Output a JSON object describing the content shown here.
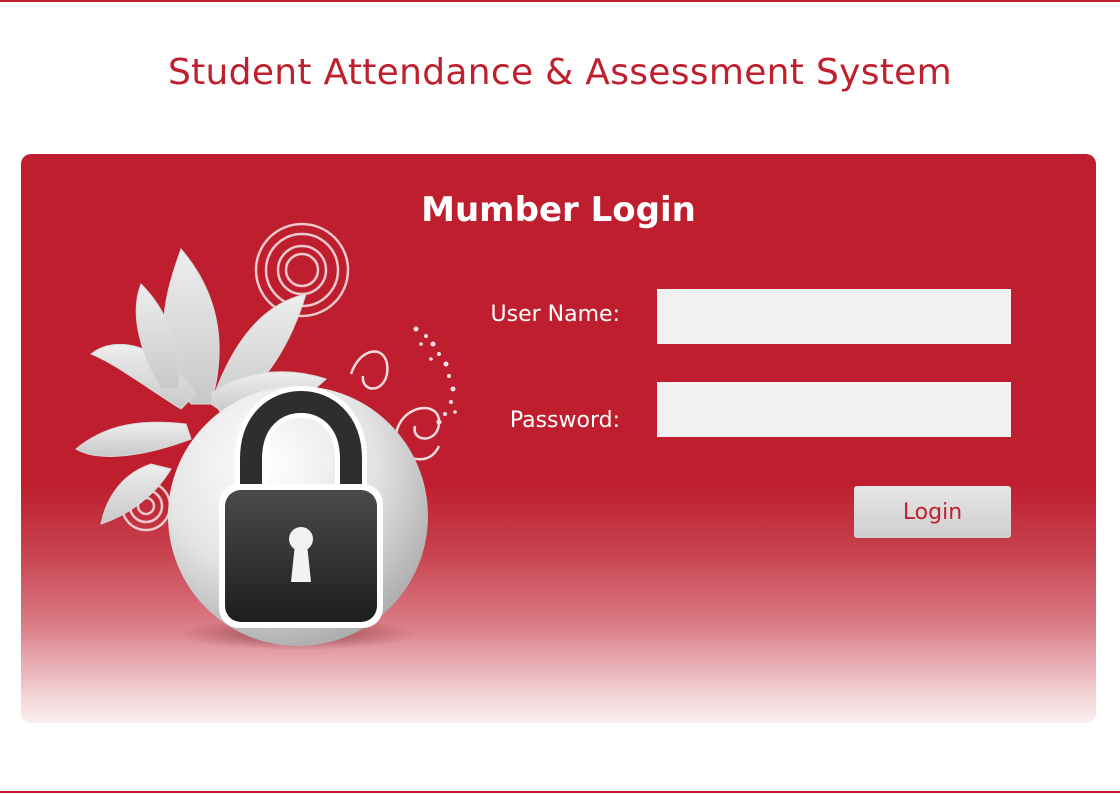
{
  "header": {
    "title": "Student Attendance & Assessment System"
  },
  "login_panel": {
    "heading": "Mumber Login",
    "username_label": "User Name:",
    "username_value": "",
    "password_label": "Password:",
    "password_value": "",
    "login_button_label": "Login",
    "illustration_icon": "lock-icon"
  },
  "colors": {
    "brand_red": "#c01f2e",
    "panel_red": "#be1e2d",
    "field_bg": "#f1f1f1",
    "button_bg": "#dadada",
    "text_white": "#ffffff"
  }
}
